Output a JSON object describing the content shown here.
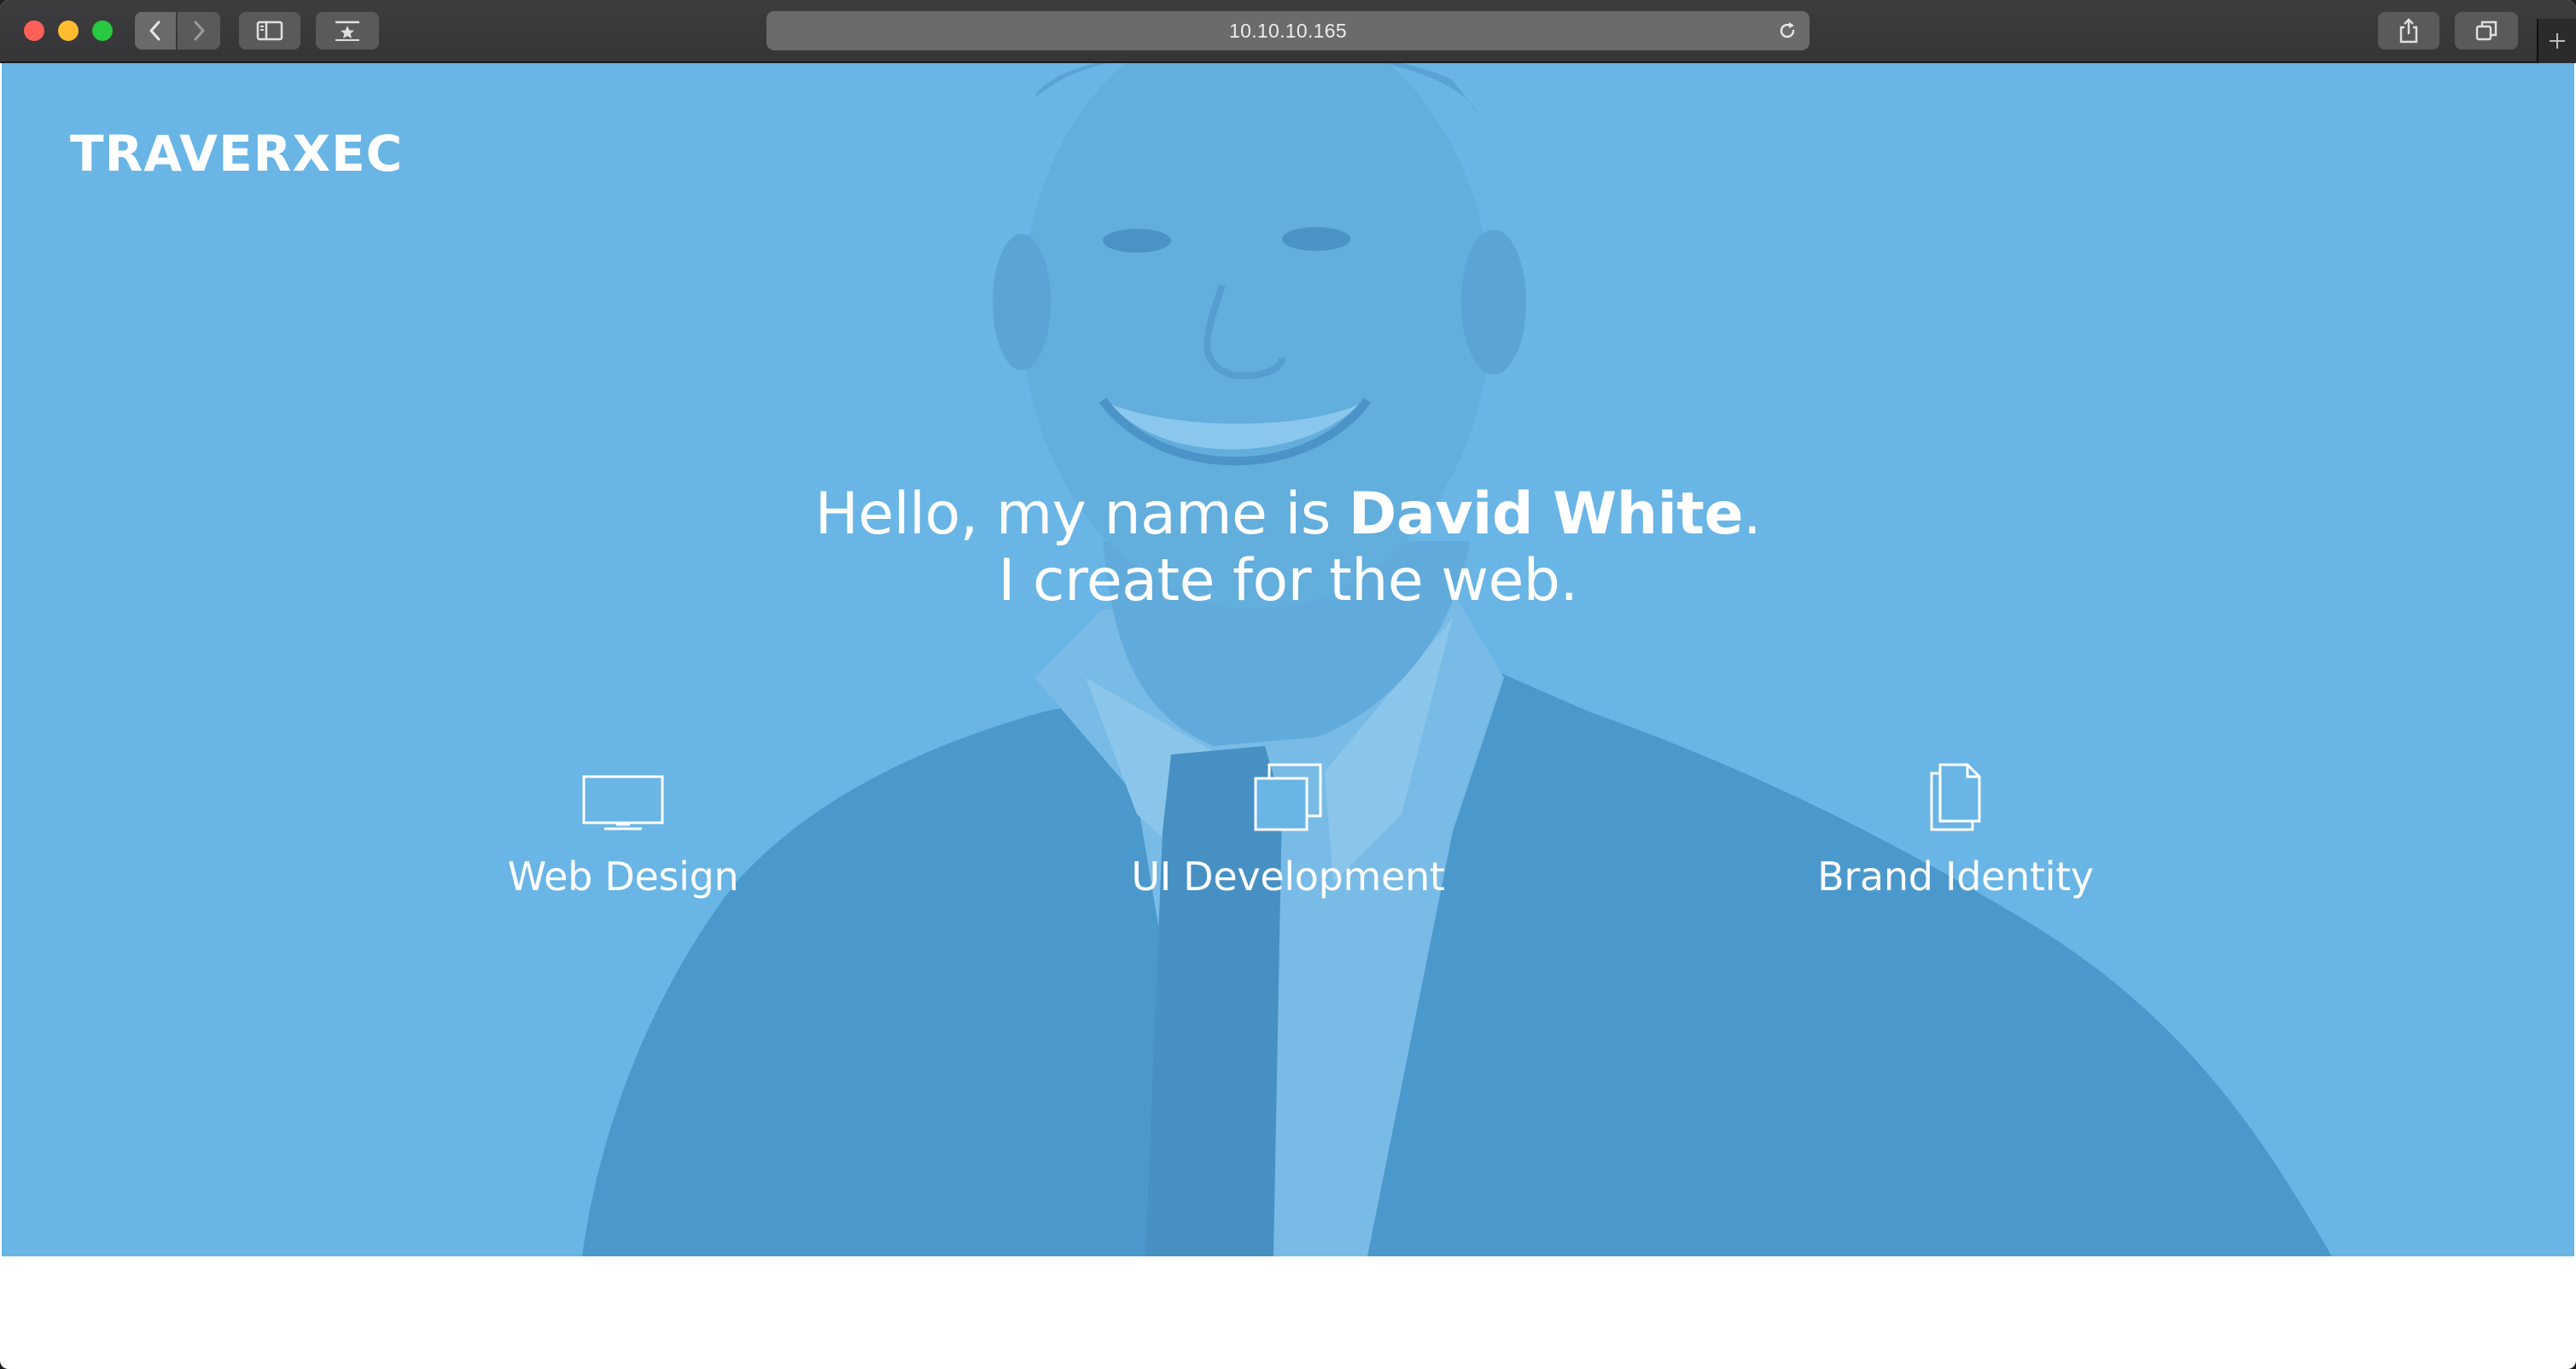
{
  "browser": {
    "url": "10.10.10.165",
    "icons": {
      "back": "chevron-left-icon",
      "forward": "chevron-right-icon",
      "sidebar": "sidebar-icon",
      "bookmarks": "bookmarks-star-icon",
      "reload": "reload-icon",
      "share": "share-icon",
      "tabs": "tabs-overview-icon",
      "new_tab": "plus-icon"
    }
  },
  "site": {
    "logo": "TRAVERXEC",
    "hero": {
      "greeting_prefix": "Hello, my name is ",
      "name": "David White",
      "greeting_suffix": ".",
      "tagline": "I create for the web."
    },
    "services": [
      {
        "label": "Web Design",
        "icon": "monitor-icon"
      },
      {
        "label": "UI Development",
        "icon": "stacked-windows-icon"
      },
      {
        "label": "Brand Identity",
        "icon": "documents-icon"
      }
    ]
  },
  "colors": {
    "hero_overlay": "#68b5e6",
    "text": "#ffffff",
    "toolbar": "#3a3a3c",
    "url_bar": "#6b6b6d"
  }
}
